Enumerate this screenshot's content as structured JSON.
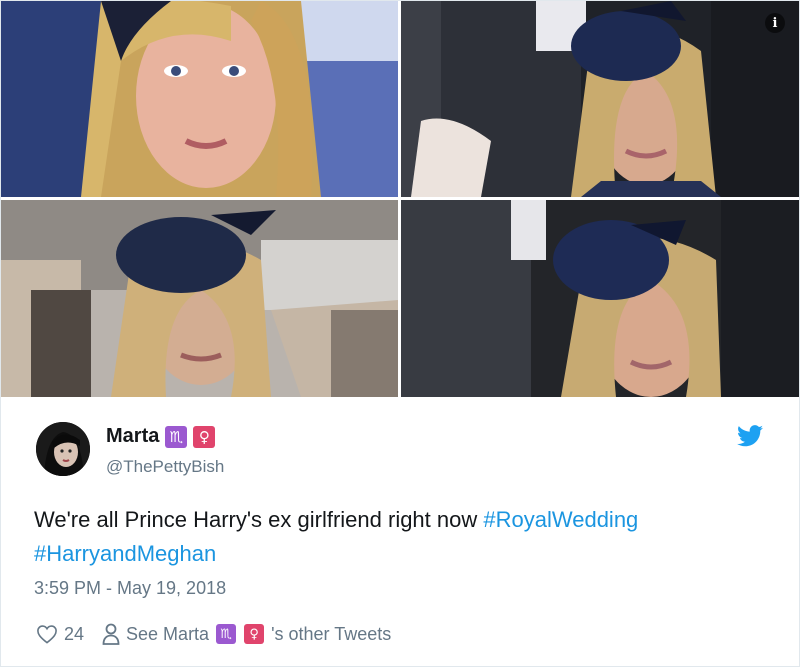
{
  "media": {
    "tiles": [
      "photo-1",
      "photo-2",
      "photo-3",
      "photo-4"
    ],
    "info_glyph": "i"
  },
  "author": {
    "display_name": "Marta",
    "handle": "@ThePettyBish",
    "badges": [
      {
        "glyph": "♏",
        "icon": "scorpio-icon",
        "color": "#9b59d0"
      },
      {
        "glyph": "♀",
        "icon": "female-sign-icon",
        "color": "#e0446c"
      }
    ]
  },
  "tweet": {
    "text_plain": "We're all Prince Harry's ex girlfriend right now ",
    "hashtag_1": "#RoyalWedding",
    "hashtag_2": "#HarryandMeghan",
    "timestamp": "3:59 PM - May 19, 2018"
  },
  "actions": {
    "like_count": "24",
    "see_prefix": "See Marta",
    "see_suffix": "'s other Tweets"
  },
  "colors": {
    "link": "#1b95e0",
    "muted": "#657786",
    "text": "#14171a",
    "twitter_blue": "#1da1f2"
  }
}
